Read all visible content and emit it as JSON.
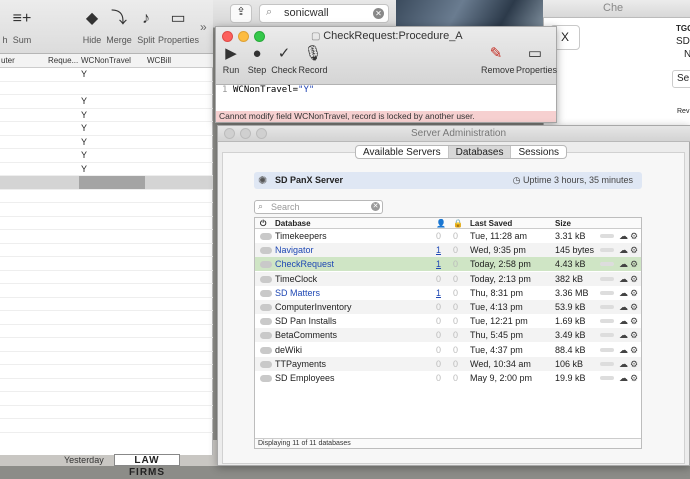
{
  "sheet": {
    "toolbar": [
      {
        "label": "h",
        "icon": "unknown-icon",
        "glyph": ""
      },
      {
        "label": "Sum",
        "icon": "sum-icon",
        "glyph": "≡+"
      },
      {
        "label": "Hide",
        "icon": "bookmark-icon",
        "glyph": "◆"
      },
      {
        "label": "Merge",
        "icon": "merge-icon",
        "glyph": "⤵"
      },
      {
        "label": "Split",
        "icon": "split-icon",
        "glyph": "♪"
      },
      {
        "label": "Properties",
        "icon": "properties-icon",
        "glyph": "▭"
      }
    ],
    "overflow": "»",
    "columns": [
      "uter",
      "Reque...",
      "WCNonTravel",
      "WCBill"
    ],
    "rows": [
      "Y",
      "",
      "Y",
      "Y",
      "Y",
      "Y",
      "Y",
      "Y",
      ""
    ],
    "footer": {
      "yesterday": "Yesterday",
      "law": "LAW FIRMS"
    }
  },
  "browser": {
    "url": "sonicwall",
    "share_icon": "⇪"
  },
  "right_window": {
    "title": "Che",
    "close_label": "X",
    "lines": [
      "TGO",
      "SD",
      "N",
      "Se",
      "Rev"
    ]
  },
  "checkrequest": {
    "title": "CheckRequest:Procedure_A",
    "tools": [
      {
        "label": "Run",
        "glyph": "▶",
        "icon": "run-icon"
      },
      {
        "label": "Step",
        "glyph": "●",
        "icon": "step-icon"
      },
      {
        "label": "Check",
        "glyph": "✓",
        "icon": "check-icon"
      },
      {
        "label": "Record",
        "glyph": "🎙",
        "icon": "record-icon"
      },
      {
        "label": "Remove",
        "glyph": "✎",
        "icon": "remove-icon"
      },
      {
        "label": "Properties",
        "glyph": "▭",
        "icon": "properties-icon"
      }
    ],
    "line_no": "1",
    "code_field": "WCNonTravel=",
    "code_value": "\"Y\"",
    "error": "Cannot modify field WCNonTravel, record is locked by another user."
  },
  "server_admin": {
    "title": "Server Administration",
    "tabs": [
      "Available Servers",
      "Databases",
      "Sessions"
    ],
    "active_tab": "Databases",
    "server_name": "SD PanX Server",
    "uptime": "Uptime 3 hours, 35 minutes",
    "search_placeholder": "Search",
    "headers": {
      "database": "Database",
      "saved": "Last Saved",
      "size": "Size"
    },
    "rows": [
      {
        "name": "Timekeepers",
        "c1": "0",
        "c2": "0",
        "saved": "Tue, 11:28 am",
        "size": "3.31 kB",
        "link": false
      },
      {
        "name": "Navigator",
        "c1": "1",
        "c2": "0",
        "saved": "Wed, 9:35 pm",
        "size": "145 bytes",
        "link": true
      },
      {
        "name": "CheckRequest",
        "c1": "1",
        "c2": "0",
        "saved": "Today, 2:58 pm",
        "size": "4.43 kB",
        "link": true
      },
      {
        "name": "TimeClock",
        "c1": "0",
        "c2": "0",
        "saved": "Today, 2:13 pm",
        "size": "382 kB",
        "link": false
      },
      {
        "name": "SD Matters",
        "c1": "1",
        "c2": "0",
        "saved": "Thu, 8:31 pm",
        "size": "3.36 MB",
        "link": true
      },
      {
        "name": "ComputerInventory",
        "c1": "0",
        "c2": "0",
        "saved": "Tue, 4:13 pm",
        "size": "53.9 kB",
        "link": false
      },
      {
        "name": "SD Pan Installs",
        "c1": "0",
        "c2": "0",
        "saved": "Tue, 12:21 pm",
        "size": "1.69 kB",
        "link": false
      },
      {
        "name": "BetaComments",
        "c1": "0",
        "c2": "0",
        "saved": "Thu, 5:45 pm",
        "size": "3.49 kB",
        "link": false
      },
      {
        "name": "deWiki",
        "c1": "0",
        "c2": "0",
        "saved": "Tue, 4:37 pm",
        "size": "88.4 kB",
        "link": false
      },
      {
        "name": "TTPayments",
        "c1": "0",
        "c2": "0",
        "saved": "Wed, 10:34 am",
        "size": "106 kB",
        "link": false
      },
      {
        "name": "SD Employees",
        "c1": "0",
        "c2": "0",
        "saved": "May 9, 2:00 pm",
        "size": "19.9 kB",
        "link": false
      }
    ],
    "footer": "Displaying 11 of 11 databases"
  }
}
